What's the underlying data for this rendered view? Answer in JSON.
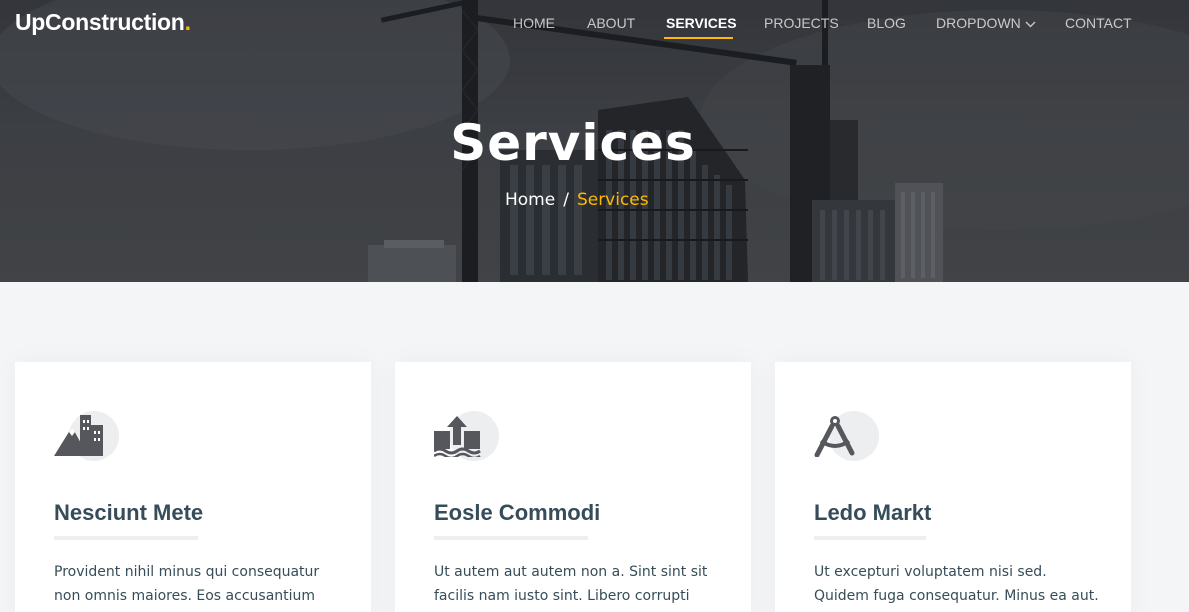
{
  "brand": {
    "name": "UpConstruction",
    "dot": ".",
    "accent": "#feb900"
  },
  "nav": {
    "items": [
      {
        "label": "HOME"
      },
      {
        "label": "ABOUT"
      },
      {
        "label": "SERVICES",
        "active": true
      },
      {
        "label": "PROJECTS"
      },
      {
        "label": "BLOG"
      },
      {
        "label": "DROPDOWN",
        "icon": "chevron-down-icon"
      },
      {
        "label": "CONTACT"
      }
    ]
  },
  "hero": {
    "title": "Services",
    "breadcrumb": {
      "home": "Home",
      "separator": "/",
      "current": "Services"
    }
  },
  "services": [
    {
      "icon": "mountain-city-icon",
      "title": "Nesciunt Mete",
      "text": "Provident nihil minus qui consequatur non omnis maiores. Eos accusantium"
    },
    {
      "icon": "arrow-up-from-ground-water-icon",
      "title": "Eosle Commodi",
      "text": "Ut autem aut autem non a. Sint sint sit facilis nam iusto sint. Libero corrupti"
    },
    {
      "icon": "compass-drafting-icon",
      "title": "Ledo Markt",
      "text": "Ut excepturi voluptatem nisi sed. Quidem fuga consequatur. Minus ea aut. Vel qui id"
    }
  ],
  "colors": {
    "heading": "#364d59",
    "page_bg": "#f4f5f7",
    "accent": "#feb900"
  }
}
